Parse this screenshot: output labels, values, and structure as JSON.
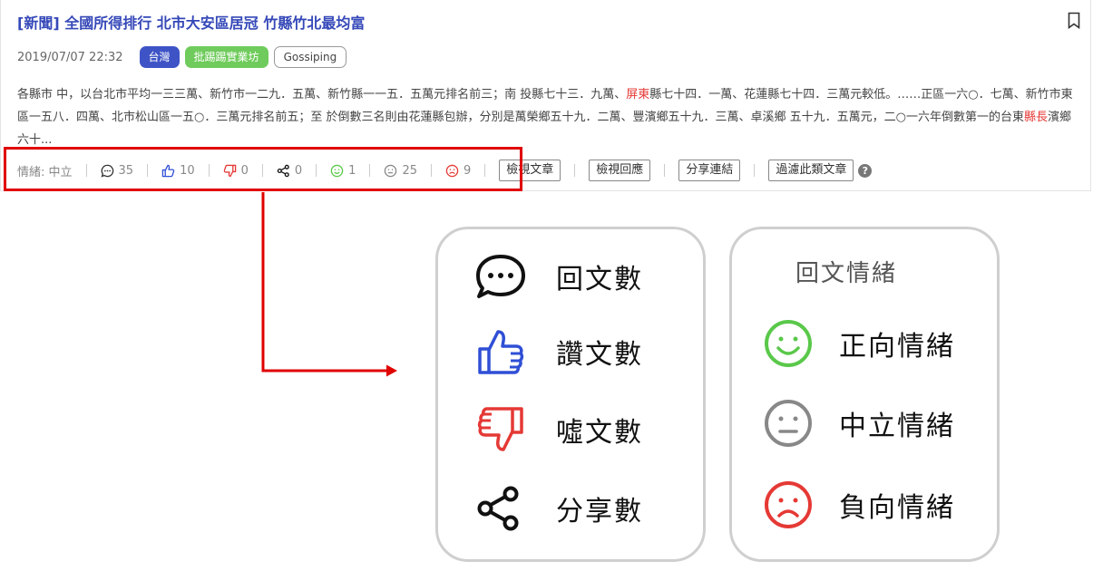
{
  "post": {
    "title": "[新聞] 全國所得排行 北市大安區居冠 竹縣竹北最均富",
    "date": "2019/07/07 22:32",
    "tags": [
      "台灣",
      "批踢踢實業坊",
      "Gossiping"
    ],
    "excerpt_part1": "各縣市 中，以台北市平均一三三萬、新竹市一二九．五萬、新竹縣一一五．五萬元排名前三；南 投縣七十三．九萬、",
    "excerpt_hl1": "屏東",
    "excerpt_part2": "縣七十四．一萬、花蓮縣七十四．三萬元較低。……正區一六○．七萬、新竹市東區一五八．四萬、北市松山區一五○．三萬元排名前五；至 於倒數三名則由花蓮縣包辦，分別是萬榮鄉五十九．二萬、豐濱鄉五十九．三萬、卓溪鄉 五十九．五萬元，二○一六年倒數第一的台東",
    "excerpt_hl2": "縣長",
    "excerpt_part3": "濱鄉六十..."
  },
  "stats": {
    "sentiment": "情緒: 中立",
    "comments": "35",
    "likes": "10",
    "dislikes": "0",
    "shares": "0",
    "positive": "1",
    "neutral": "25",
    "negative": "9"
  },
  "actions": {
    "view_article": "檢視文章",
    "view_replies": "檢視回應",
    "share_link": "分享連結",
    "filter_similar": "過濾此類文章",
    "help": "?"
  },
  "legend": {
    "comments_label": "回文數",
    "likes_label": "讚文數",
    "dislikes_label": "噓文數",
    "shares_label": "分享數",
    "sentiment_title": "回文情緒",
    "positive_label": "正向情緒",
    "neutral_label": "中立情緒",
    "negative_label": "負向情緒"
  },
  "colors": {
    "title_blue": "#3548b8",
    "tag_blue": "#3e54c6",
    "tag_green": "#6fcb5b",
    "highlight_red": "#e00000",
    "like_blue": "#2f4fd6",
    "dislike_red": "#e53935",
    "positive_green": "#5ac84a",
    "neutral_gray": "#888888",
    "negative_red": "#e53935"
  },
  "icons": [
    "bookmark-icon",
    "comment-icon",
    "thumbs-up-icon",
    "thumbs-down-icon",
    "share-icon",
    "smile-icon",
    "neutral-face-icon",
    "sad-face-icon",
    "help-icon"
  ]
}
